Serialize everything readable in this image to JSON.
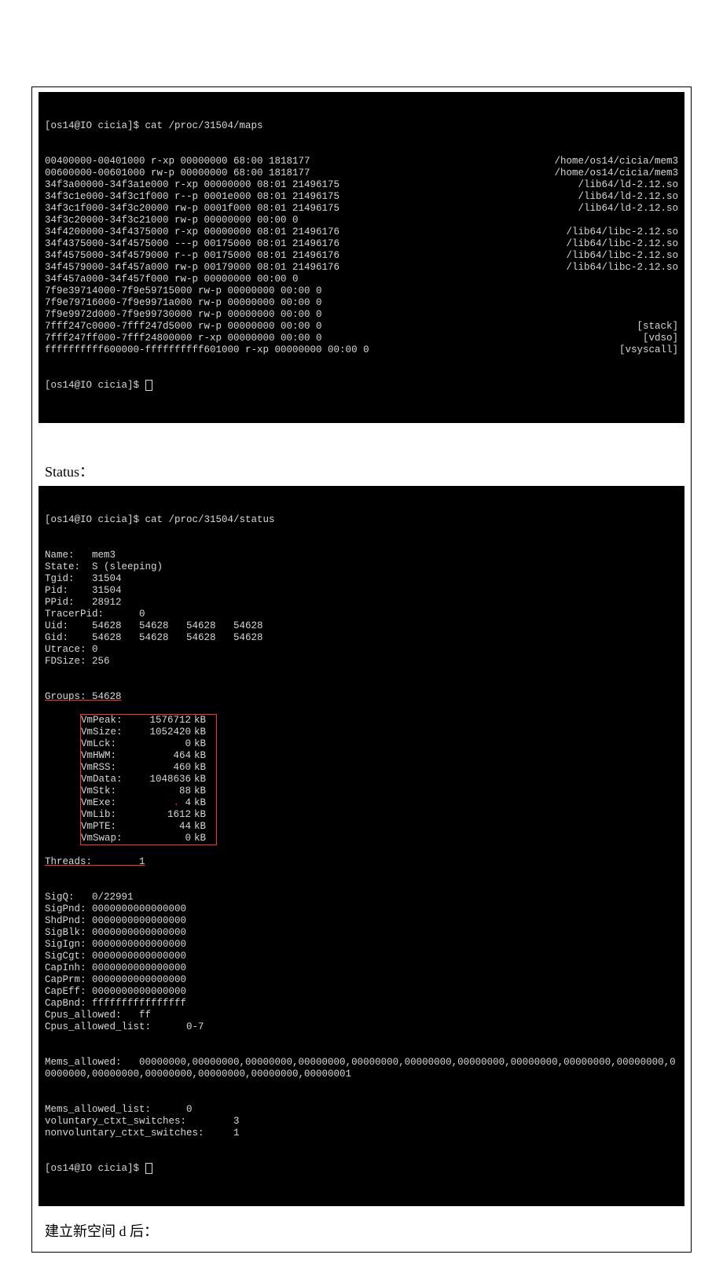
{
  "maps": {
    "prompt": "[os14@IO cicia]$ cat /proc/31504/maps",
    "rows": [
      {
        "l": "00400000-00401000 r-xp 00000000 68:00 1818177",
        "r": "/home/os14/cicia/mem3"
      },
      {
        "l": "00600000-00601000 rw-p 00000000 68:00 1818177",
        "r": "/home/os14/cicia/mem3"
      },
      {
        "l": "34f3a00000-34f3a1e000 r-xp 00000000 08:01 21496175",
        "r": "/lib64/ld-2.12.so"
      },
      {
        "l": "34f3c1e000-34f3c1f000 r--p 0001e000 08:01 21496175",
        "r": "/lib64/ld-2.12.so"
      },
      {
        "l": "34f3c1f000-34f3c20000 rw-p 0001f000 08:01 21496175",
        "r": "/lib64/ld-2.12.so"
      },
      {
        "l": "34f3c20000-34f3c21000 rw-p 00000000 00:00 0",
        "r": ""
      },
      {
        "l": "34f4200000-34f4375000 r-xp 00000000 08:01 21496176",
        "r": "/lib64/libc-2.12.so"
      },
      {
        "l": "34f4375000-34f4575000 ---p 00175000 08:01 21496176",
        "r": "/lib64/libc-2.12.so"
      },
      {
        "l": "34f4575000-34f4579000 r--p 00175000 08:01 21496176",
        "r": "/lib64/libc-2.12.so"
      },
      {
        "l": "34f4579000-34f457a000 rw-p 00179000 08:01 21496176",
        "r": "/lib64/libc-2.12.so"
      },
      {
        "l": "34f457a000-34f457f000 rw-p 00000000 00:00 0",
        "r": ""
      },
      {
        "l": "7f9e39714000-7f9e59715000 rw-p 00000000 00:00 0",
        "r": ""
      },
      {
        "l": "7f9e79716000-7f9e9971a000 rw-p 00000000 00:00 0",
        "r": ""
      },
      {
        "l": "7f9e9972d000-7f9e99730000 rw-p 00000000 00:00 0",
        "r": ""
      },
      {
        "l": "7fff247c0000-7fff247d5000 rw-p 00000000 00:00 0",
        "r": "[stack]"
      },
      {
        "l": "7fff247ff000-7fff24800000 r-xp 00000000 00:00 0",
        "r": "[vdso]"
      },
      {
        "l": "ffffffffff600000-ffffffffff601000 r-xp 00000000 00:00 0",
        "r": "[vsyscall]"
      }
    ],
    "after_prompt": "[os14@IO cicia]$ "
  },
  "labels": {
    "status": "Status：",
    "after_d": "建立新空间 d 后："
  },
  "status": {
    "prompt": "[os14@IO cicia]$ cat /proc/31504/status",
    "pre_groups": [
      "Name:   mem3",
      "State:  S (sleeping)",
      "Tgid:   31504",
      "Pid:    31504",
      "PPid:   28912",
      "TracerPid:      0",
      "Uid:    54628   54628   54628   54628",
      "Gid:    54628   54628   54628   54628",
      "Utrace: 0",
      "FDSize: 256"
    ],
    "groups_line": "Groups: 54628",
    "vm": [
      {
        "k": "VmPeak:",
        "v": "1576712",
        "u": "kB",
        "dot": false
      },
      {
        "k": "VmSize:",
        "v": "1052420",
        "u": "kB",
        "dot": false
      },
      {
        "k": "VmLck:",
        "v": "0",
        "u": "kB",
        "dot": false
      },
      {
        "k": "VmHWM:",
        "v": "464",
        "u": "kB",
        "dot": false
      },
      {
        "k": "VmRSS:",
        "v": "460",
        "u": "kB",
        "dot": false
      },
      {
        "k": "VmData:",
        "v": "1048636",
        "u": "kB",
        "dot": false
      },
      {
        "k": "VmStk:",
        "v": "88",
        "u": "kB",
        "dot": false
      },
      {
        "k": "VmExe:",
        "v": "4",
        "u": "kB",
        "dot": true
      },
      {
        "k": "VmLib:",
        "v": "1612",
        "u": "kB",
        "dot": false
      },
      {
        "k": "VmPTE:",
        "v": "44",
        "u": "kB",
        "dot": false
      },
      {
        "k": "VmSwap:",
        "v": "0",
        "u": "kB",
        "dot": false
      }
    ],
    "threads_line": "Threads:        1",
    "post_threads": [
      "SigQ:   0/22991",
      "SigPnd: 0000000000000000",
      "ShdPnd: 0000000000000000",
      "SigBlk: 0000000000000000",
      "SigIgn: 0000000000000000",
      "SigCgt: 0000000000000000",
      "CapInh: 0000000000000000",
      "CapPrm: 0000000000000000",
      "CapEff: 0000000000000000",
      "CapBnd: ffffffffffffffff",
      "Cpus_allowed:   ff",
      "Cpus_allowed_list:      0-7"
    ],
    "mems_allowed": "Mems_allowed:   00000000,00000000,00000000,00000000,00000000,00000000,00000000,00000000,00000000,00000000,00000000,00000000,00000000,00000000,00000000,00000001",
    "tail": [
      "Mems_allowed_list:      0",
      "voluntary_ctxt_switches:        3",
      "nonvoluntary_ctxt_switches:     1"
    ],
    "after_prompt": "[os14@IO cicia]$ "
  }
}
